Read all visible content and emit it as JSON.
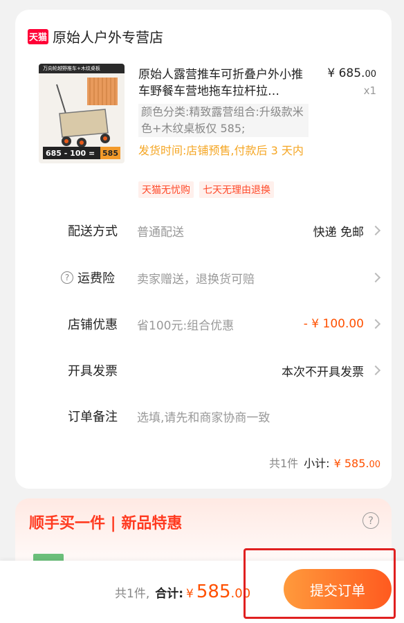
{
  "shop": {
    "badge": "天猫",
    "name": "原始人户外专营店"
  },
  "product": {
    "image_top_text": "万向轮越野推车+木纹桌板",
    "image_price_text": "685 - 100 =",
    "image_price_result": "585",
    "title": "原始人露营推车可折叠户外小推车野餐车营地拖车拉杆拉…",
    "price_main": "¥ 685.",
    "price_decimal": "00",
    "quantity": "x1",
    "spec": "颜色分类:精致露营组合:升级款米色+木纹桌板仅 585;",
    "ship_time": "发货时间:店铺预售,付款后 3 天内",
    "tags": [
      "天猫无忧购",
      "七天无理由退换"
    ]
  },
  "rows": {
    "delivery": {
      "label": "配送方式",
      "value": "普通配送",
      "right": "快递 免邮"
    },
    "insurance": {
      "label": "运费险",
      "value": "卖家赠送，退换货可赔"
    },
    "discount": {
      "label": "店铺优惠",
      "value": "省100元:组合优惠",
      "right": "- ¥ 100.00"
    },
    "invoice": {
      "label": "开具发票",
      "right": "本次不开具发票"
    },
    "note": {
      "label": "订单备注",
      "placeholder": "选填,请先和商家协商一致"
    }
  },
  "subtotal": {
    "count": "共1件",
    "label": "小计:",
    "amount": "¥ 585.",
    "decimal": "00"
  },
  "promo": {
    "title": "顺手买一件 | 新品特惠",
    "help": "?"
  },
  "bottom": {
    "count": "共1件,",
    "label": "合计:",
    "currency": "¥",
    "amount": "585",
    "decimal": ".00",
    "submit": "提交订单"
  },
  "colors": {
    "accent": "#ff5000",
    "tmall_red": "#ff0036",
    "highlight": "#e02020"
  }
}
